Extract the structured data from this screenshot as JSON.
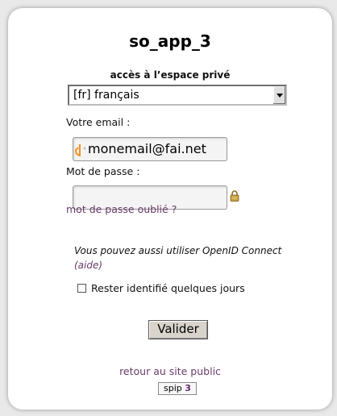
{
  "app": {
    "title": "so_app_3"
  },
  "login": {
    "section_label": "accès à l’espace privé",
    "language_selected": "[fr] français",
    "email_label": "Votre email :",
    "email_value": "monemail@fai.net",
    "password_label": "Mot de passe :",
    "password_value": "",
    "forgot_password_link": "mot de passe oublié ?",
    "openid_note": "Vous pouvez aussi utiliser OpenID Connect",
    "openid_help_link": "(aide)",
    "remember_label": "Rester identifié quelques jours",
    "remember_checked": false,
    "submit_label": "Valider"
  },
  "footer": {
    "public_site_link": "retour au site public",
    "badge_text": "spip",
    "badge_version": "3"
  },
  "colors": {
    "link": "#6a3a6a",
    "card_background": "#ffffff",
    "page_background": "#e9e9e9"
  }
}
